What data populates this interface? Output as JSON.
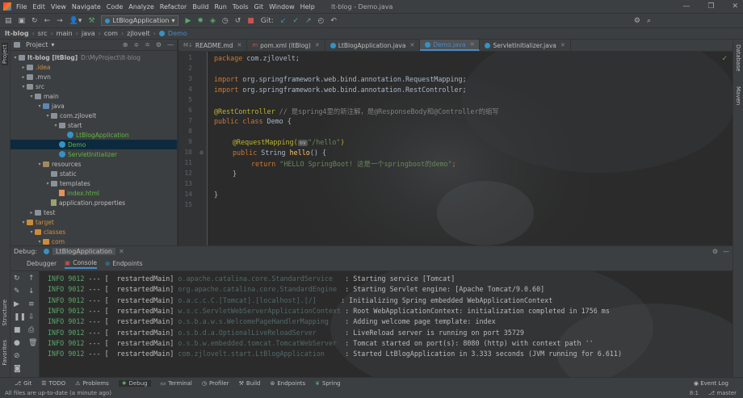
{
  "menu": [
    "File",
    "Edit",
    "View",
    "Navigate",
    "Code",
    "Analyze",
    "Refactor",
    "Build",
    "Run",
    "Tools",
    "Git",
    "Window",
    "Help"
  ],
  "window_title": "lt-blog - Demo.java",
  "toolbar": {
    "run_config": "LtBlogApplication",
    "git_label": "Git:"
  },
  "breadcrumb": [
    "lt-blog",
    "src",
    "main",
    "java",
    "com",
    "zjlovelt",
    "Demo"
  ],
  "left_stripe": {
    "project": "Project",
    "structure": "Structure",
    "favorites": "Favorites"
  },
  "right_stripe": {
    "database": "Database",
    "maven": "Maven"
  },
  "project_panel": {
    "title": "Project"
  },
  "tree": [
    {
      "label": "lt-blog [ltBlog]",
      "extra": "D:\\MyProject\\lt-blog",
      "level": 0,
      "arrow": "▾",
      "icon": "folder",
      "color": "normal"
    },
    {
      "label": ".idea",
      "level": 1,
      "arrow": "▸",
      "icon": "folder",
      "color": "orange"
    },
    {
      "label": ".mvn",
      "level": 1,
      "arrow": "▸",
      "icon": "folder",
      "color": "normal"
    },
    {
      "label": "src",
      "level": 1,
      "arrow": "▾",
      "icon": "folder",
      "color": "normal"
    },
    {
      "label": "main",
      "level": 2,
      "arrow": "▾",
      "icon": "folder",
      "color": "normal"
    },
    {
      "label": "java",
      "level": 3,
      "arrow": "▾",
      "icon": "src",
      "color": "normal"
    },
    {
      "label": "com.zjlovelt",
      "level": 4,
      "arrow": "▾",
      "icon": "pkg",
      "color": "normal"
    },
    {
      "label": "start",
      "level": 5,
      "arrow": "▾",
      "icon": "pkg",
      "color": "normal"
    },
    {
      "label": "LtBlogApplication",
      "level": 6,
      "arrow": "",
      "icon": "class",
      "color": "green"
    },
    {
      "label": "Demo",
      "level": 5,
      "arrow": "",
      "icon": "class",
      "color": "green",
      "selected": true
    },
    {
      "label": "ServletInitializer",
      "level": 5,
      "arrow": "",
      "icon": "class",
      "color": "green"
    },
    {
      "label": "resources",
      "level": 3,
      "arrow": "▾",
      "icon": "res",
      "color": "normal"
    },
    {
      "label": "static",
      "level": 4,
      "arrow": "",
      "icon": "folder",
      "color": "normal"
    },
    {
      "label": "templates",
      "level": 4,
      "arrow": "▾",
      "icon": "folder",
      "color": "normal"
    },
    {
      "label": "index.html",
      "level": 5,
      "arrow": "",
      "icon": "html",
      "color": "green"
    },
    {
      "label": "application.properties",
      "level": 4,
      "arrow": "",
      "icon": "prop",
      "color": "normal"
    },
    {
      "label": "test",
      "level": 2,
      "arrow": "▸",
      "icon": "folder",
      "color": "normal"
    },
    {
      "label": "target",
      "level": 1,
      "arrow": "▾",
      "icon": "tgt",
      "color": "orange"
    },
    {
      "label": "classes",
      "level": 2,
      "arrow": "▾",
      "icon": "tgt",
      "color": "orange"
    },
    {
      "label": "com",
      "level": 3,
      "arrow": "▾",
      "icon": "tgt",
      "color": "orange"
    }
  ],
  "tabs": [
    {
      "label": "README.md",
      "active": false
    },
    {
      "label": "pom.xml (ltBlog)",
      "active": false
    },
    {
      "label": "LtBlogApplication.java",
      "active": false
    },
    {
      "label": "Demo.java",
      "active": true
    },
    {
      "label": "ServletInitializer.java",
      "active": false
    }
  ],
  "line_numbers": [
    "1",
    "2",
    "3",
    "4",
    "5",
    "6",
    "7",
    "8",
    "9",
    "10",
    "11",
    "12",
    "13",
    "14",
    "15"
  ],
  "code": {
    "l1_kw": "package",
    "l1_rest": " com.zjlovelt;",
    "l3_kw": "import",
    "l3_rest": " org.springframework.web.bind.annotation.RequestMapping;",
    "l4_kw": "import",
    "l4_rest": " org.springframework.web.bind.annotation.RestController;",
    "l6_ann": "@RestController",
    "l6_cmt": " // 是spring4里的新注解，是@ResponseBody和@Controller的缩写",
    "l7_kw": "public class",
    "l7_rest": " Demo {",
    "l9_ann": "@RequestMapping(",
    "l9_hint": "⊙∨",
    "l9_str": "\"/hello\"",
    "l9_end": ")",
    "l10_kw": "public",
    "l10_type": " String ",
    "l10_fn": "hello",
    "l10_end": "() {",
    "l11_kw": "return",
    "l11_str": " \"HELLO SpringBoot! 这是一个springboot的demo\"",
    "l11_end": ";",
    "l12": "}",
    "l14": "}"
  },
  "debug": {
    "title": "Debug:",
    "config": "LtBlogApplication",
    "tabs": [
      "Debugger",
      "Console",
      "Endpoints"
    ]
  },
  "console_lines": [
    {
      "lvl": "INFO",
      "pid": "9012",
      "sep": " --- [",
      "thread": "  restartedMain]",
      "logger": " o.apache.catalina.core.StandardService  ",
      "msg": " : Starting service [Tomcat]"
    },
    {
      "lvl": "INFO",
      "pid": "9012",
      "sep": " --- [",
      "thread": "  restartedMain]",
      "logger": " org.apache.catalina.core.StandardEngine ",
      "msg": " : Starting Servlet engine: [Apache Tomcat/9.0.60]"
    },
    {
      "lvl": "INFO",
      "pid": "9012",
      "sep": " --- [",
      "thread": "  restartedMain]",
      "logger": " o.a.c.c.C.[Tomcat].[localhost].[/]     ",
      "msg": " : Initializing Spring embedded WebApplicationContext"
    },
    {
      "lvl": "INFO",
      "pid": "9012",
      "sep": " --- [",
      "thread": "  restartedMain]",
      "logger": " w.s.c.ServletWebServerApplicationContext",
      "msg": " : Root WebApplicationContext: initialization completed in 1756 ms"
    },
    {
      "lvl": "INFO",
      "pid": "9012",
      "sep": " --- [",
      "thread": "  restartedMain]",
      "logger": " o.s.b.a.w.s.WelcomePageHandlerMapping   ",
      "msg": " : Adding welcome page template: index"
    },
    {
      "lvl": "INFO",
      "pid": "9012",
      "sep": " --- [",
      "thread": "  restartedMain]",
      "logger": " o.s.b.d.a.OptionalLiveReloadServer      ",
      "msg": " : LiveReload server is running on port 35729"
    },
    {
      "lvl": "INFO",
      "pid": "9012",
      "sep": " --- [",
      "thread": "  restartedMain]",
      "logger": " o.s.b.w.embedded.tomcat.TomcatWebServer ",
      "msg": " : Tomcat started on port(s): 8080 (http) with context path ''"
    },
    {
      "lvl": "INFO",
      "pid": "9012",
      "sep": " --- [",
      "thread": "  restartedMain]",
      "logger": " com.zjlovelt.start.LtBlogApplication    ",
      "msg": " : Started LtBlogApplication in 3.333 seconds (JVM running for 6.611)"
    }
  ],
  "tool_windows": [
    "Git",
    "TODO",
    "Problems",
    "Debug",
    "Terminal",
    "Profiler",
    "Build",
    "Endpoints",
    "Spring"
  ],
  "event_log": "Event Log",
  "status": {
    "message": "All files are up-to-date (a minute ago)",
    "position": "8:1",
    "branch": "master"
  },
  "colors": {
    "accent": "#4a88c7",
    "keyword": "#cc7832",
    "annotation": "#bbb529",
    "string": "#6a8759",
    "info": "#59a869"
  }
}
